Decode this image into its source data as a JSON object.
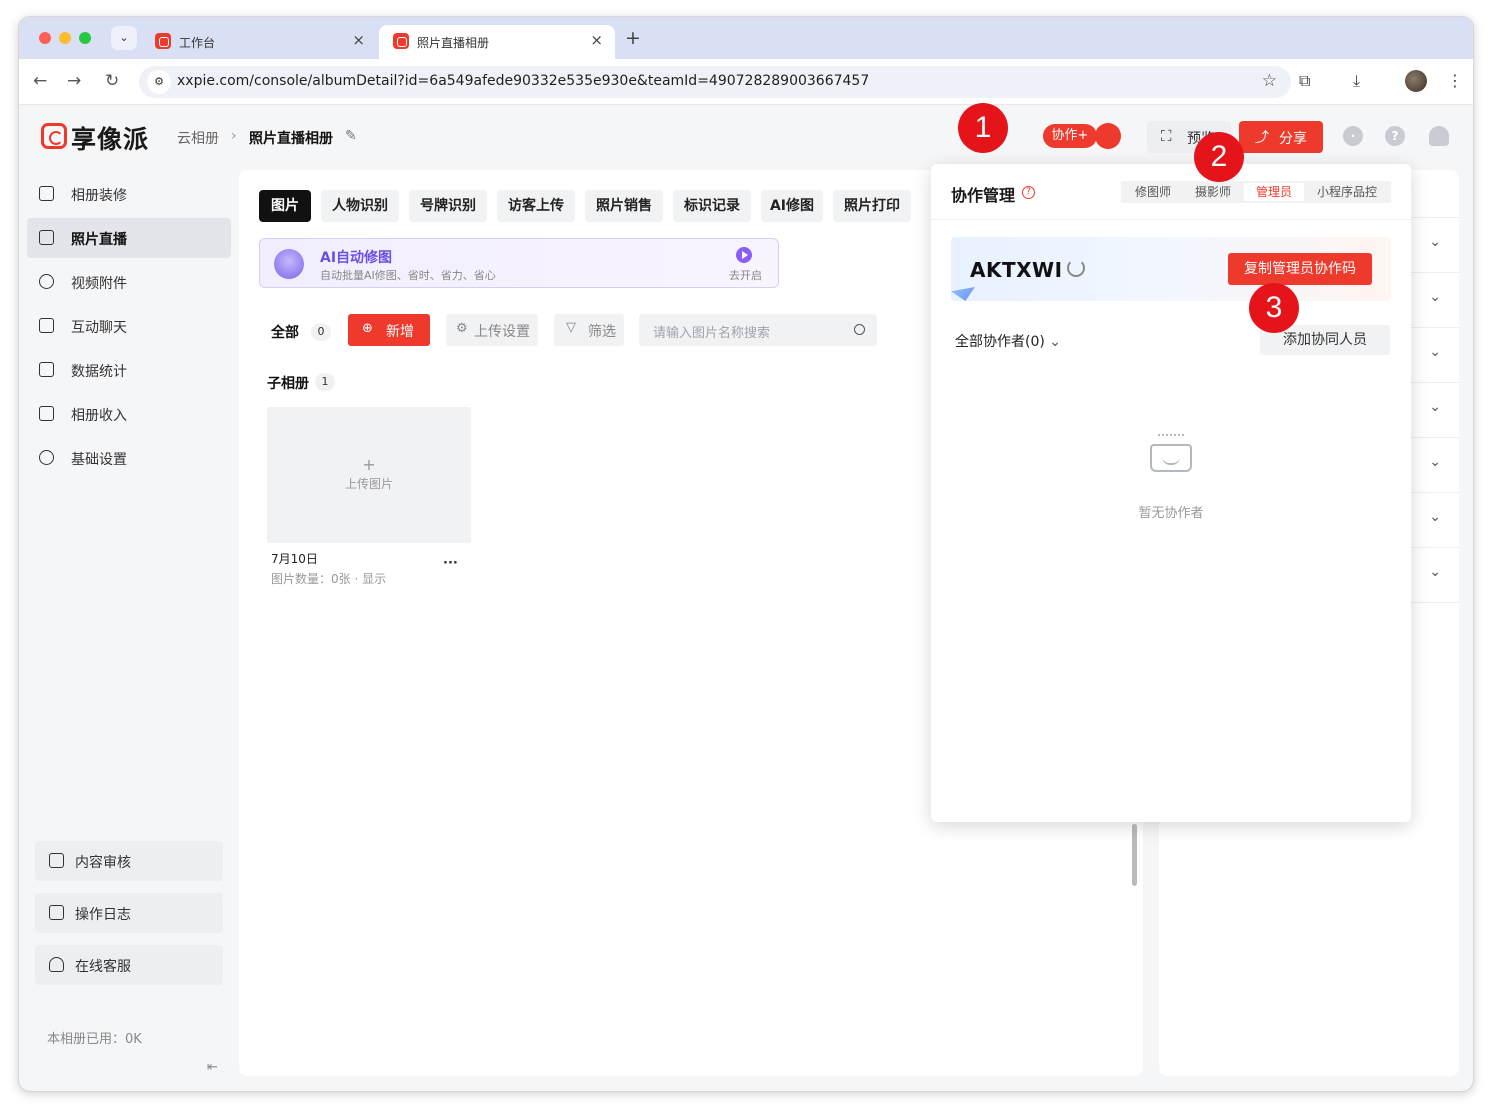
{
  "browser": {
    "tabs": [
      {
        "title": "工作台"
      },
      {
        "title": "照片直播相册"
      }
    ],
    "url": "xxpie.com/console/albumDetail?id=6a549afede90332e535e930e&teamId=490728289003667457"
  },
  "header": {
    "logo_text": "享像派",
    "breadcrumb_root": "云相册",
    "breadcrumb_current": "照片直播相册",
    "collab_badge": "协作+",
    "preview_label": "预览",
    "share_label": "分享"
  },
  "sidebar": {
    "items": [
      {
        "label": "相册装修"
      },
      {
        "label": "照片直播"
      },
      {
        "label": "视频附件"
      },
      {
        "label": "互动聊天"
      },
      {
        "label": "数据统计"
      },
      {
        "label": "相册收入"
      },
      {
        "label": "基础设置"
      }
    ],
    "bottom": [
      {
        "label": "内容审核"
      },
      {
        "label": "操作日志"
      },
      {
        "label": "在线客服"
      }
    ],
    "usage": "本相册已用：0K"
  },
  "main": {
    "tabs": [
      {
        "label": "图片"
      },
      {
        "label": "人物识别"
      },
      {
        "label": "号牌识别"
      },
      {
        "label": "访客上传"
      },
      {
        "label": "照片销售"
      },
      {
        "label": "标识记录"
      },
      {
        "label": "AI修图"
      },
      {
        "label": "照片打印"
      }
    ],
    "ai_banner": {
      "title": "AI自动修图",
      "subtitle": "自动批量AI修图、省时、省力、省心",
      "action": "去开启"
    },
    "all_label": "全部",
    "all_count": "0",
    "add_button": "新增",
    "upload_settings": "上传设置",
    "filter": "筛选",
    "search_placeholder": "请输入图片名称搜索",
    "sub_album_label": "子相册",
    "sub_album_count": "1",
    "album_card": {
      "upload_label": "上传图片",
      "date": "7月10日",
      "meta": "图片数量：0张 · 显示",
      "more": "···"
    }
  },
  "popover": {
    "title": "协作管理",
    "segments": [
      {
        "label": "修图师"
      },
      {
        "label": "摄影师"
      },
      {
        "label": "管理员"
      },
      {
        "label": "小程序品控"
      }
    ],
    "active_segment": "管理员",
    "code": "AKTXWI",
    "copy_button": "复制管理员协作码",
    "all_collaborators": "全部协作者(0)",
    "add_button": "添加协同人员",
    "empty_text": "暂无协作者"
  },
  "markers": [
    "1",
    "2",
    "3"
  ],
  "colors": {
    "accent": "#ee3a2c",
    "marker": "#e5141b",
    "ai_purple": "#6b4ee6"
  }
}
